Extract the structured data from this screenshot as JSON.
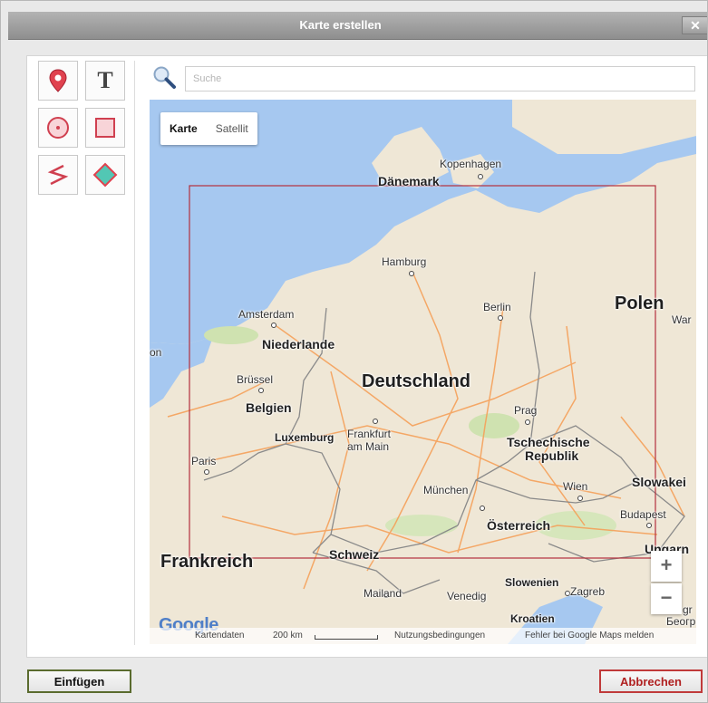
{
  "window": {
    "title": "Karte erstellen",
    "close_glyph": "✕"
  },
  "toolbox": {
    "tools": [
      {
        "name": "marker-tool",
        "icon": "map-pin-icon"
      },
      {
        "name": "text-tool",
        "icon": "text-icon",
        "glyph": "T"
      },
      {
        "name": "circle-tool",
        "icon": "circle-icon"
      },
      {
        "name": "rectangle-tool",
        "icon": "rectangle-icon"
      },
      {
        "name": "polyline-tool",
        "icon": "polyline-icon"
      },
      {
        "name": "polygon-tool",
        "icon": "polygon-icon"
      }
    ]
  },
  "search": {
    "placeholder": "Suche",
    "value": ""
  },
  "map": {
    "type_control": {
      "map": "Karte",
      "satellite": "Satellit",
      "selected": "Karte"
    },
    "cities": {
      "kopenhagen": "Kopenhagen",
      "hamburg": "Hamburg",
      "berlin": "Berlin",
      "amsterdam": "Amsterdam",
      "bruessel": "Brüssel",
      "frankfurt_1": "Frankfurt",
      "frankfurt_2": "am Main",
      "prag": "Prag",
      "paris": "Paris",
      "muenchen": "München",
      "wien": "Wien",
      "budapest": "Budapest",
      "mailand": "Mailand",
      "venedig": "Venedig",
      "zagreb": "Zagreb"
    },
    "countries": {
      "daenemark": "Dänemark",
      "polen": "Polen",
      "niederlande": "Niederlande",
      "deutschland": "Deutschland",
      "belgien": "Belgien",
      "luxemburg": "Luxemburg",
      "tschechische_1": "Tschechische",
      "tschechische_2": "Republik",
      "slowakei": "Slowakei",
      "oesterreich": "Österreich",
      "frankreich": "Frankreich",
      "schweiz": "Schweiz",
      "ungarn": "Ungarn",
      "slowenien": "Slowenien",
      "kroatien": "Kroatien",
      "partial_war": "War",
      "partial_on": "on",
      "partial_gr": "gr",
      "partial_beogr": "Беогр"
    },
    "zoom_in": "+",
    "zoom_out": "−",
    "attribution": {
      "logo": "Google",
      "kartendaten": "Kartendaten",
      "scale": "200 km",
      "terms": "Nutzungsbedingungen",
      "report": "Fehler bei Google Maps melden"
    },
    "colors": {
      "water": "#a6c8f0",
      "land": "#efe7d6",
      "selection": "#b3303c"
    }
  },
  "buttons": {
    "insert": "Einfügen",
    "cancel": "Abbrechen"
  }
}
